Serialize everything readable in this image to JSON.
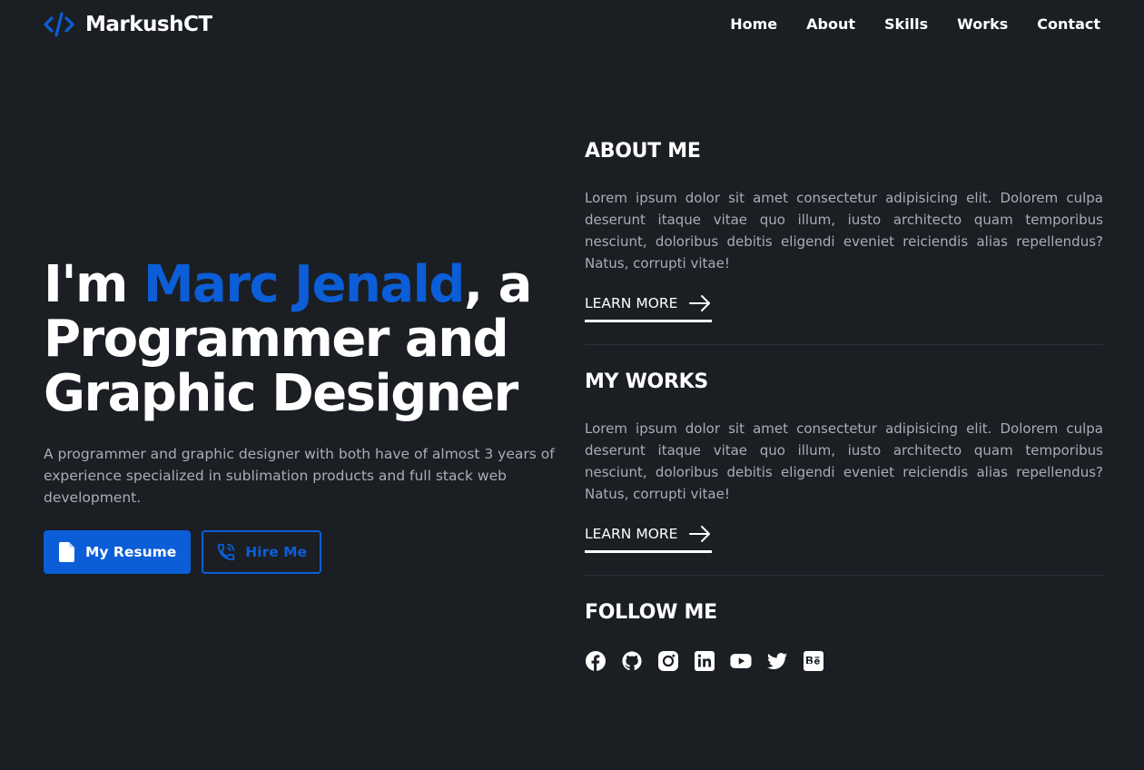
{
  "brand": {
    "name": "MarkushCT",
    "accent_color": "#0b5ed7"
  },
  "nav": {
    "items": [
      {
        "label": "Home"
      },
      {
        "label": "About"
      },
      {
        "label": "Skills"
      },
      {
        "label": "Works"
      },
      {
        "label": "Contact"
      }
    ]
  },
  "hero": {
    "title_prefix": "I'm ",
    "title_name": "Marc Jenald",
    "title_suffix": ", a Programmer and Graphic Designer",
    "description": "A programmer and graphic designer with both have of almost 3 years of experience specialized in sublimation products and full stack web development.",
    "resume_label": "My Resume",
    "hire_label": "Hire Me"
  },
  "about": {
    "title": "ABOUT ME",
    "text": "Lorem ipsum dolor sit amet consectetur adipisicing elit. Dolorem culpa deserunt itaque vitae quo illum, iusto architecto quam temporibus nesciunt, doloribus debitis eligendi eveniet reiciendis alias repellendus? Natus, corrupti vitae!",
    "link": "LEARN MORE"
  },
  "works": {
    "title": "MY WORKS",
    "text": "Lorem ipsum dolor sit amet consectetur adipisicing elit. Dolorem culpa deserunt itaque vitae quo illum, iusto architecto quam temporibus nesciunt, doloribus debitis eligendi eveniet reiciendis alias repellendus? Natus, corrupti vitae!",
    "link": "LEARN MORE"
  },
  "follow": {
    "title": "FOLLOW ME",
    "icons": [
      "facebook-icon",
      "github-icon",
      "instagram-icon",
      "linkedin-icon",
      "youtube-icon",
      "twitter-icon",
      "behance-icon"
    ]
  }
}
